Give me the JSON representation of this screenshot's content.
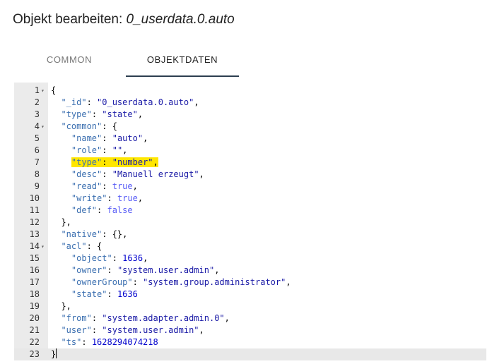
{
  "dialog": {
    "title_prefix": "Objekt bearbeiten: ",
    "object_id": "0_userdata.0.auto"
  },
  "tabs": [
    {
      "label": "COMMON",
      "active": false
    },
    {
      "label": "OBJEKTDATEN",
      "active": true
    }
  ],
  "editor": {
    "active_line": 23,
    "fold_icon": "triangle-down-icon",
    "colors": {
      "gutter": "#ebebeb",
      "key": "#3b6fb0",
      "string": "#1a1aa6",
      "number": "#0000cd",
      "highlight": "#ffe600"
    },
    "lines": [
      {
        "n": "1",
        "fold": true,
        "tokens": [
          {
            "t": "{"
          }
        ]
      },
      {
        "n": "2",
        "tokens": [
          {
            "t": "  "
          },
          {
            "t": "\"_id\"",
            "c": "k"
          },
          {
            "t": ": "
          },
          {
            "t": "\"0_userdata.0.auto\"",
            "c": "s"
          },
          {
            "t": ","
          }
        ]
      },
      {
        "n": "3",
        "tokens": [
          {
            "t": "  "
          },
          {
            "t": "\"type\"",
            "c": "k"
          },
          {
            "t": ": "
          },
          {
            "t": "\"state\"",
            "c": "s"
          },
          {
            "t": ","
          }
        ]
      },
      {
        "n": "4",
        "fold": true,
        "tokens": [
          {
            "t": "  "
          },
          {
            "t": "\"common\"",
            "c": "k"
          },
          {
            "t": ": {"
          }
        ]
      },
      {
        "n": "5",
        "tokens": [
          {
            "t": "    "
          },
          {
            "t": "\"name\"",
            "c": "k"
          },
          {
            "t": ": "
          },
          {
            "t": "\"auto\"",
            "c": "s"
          },
          {
            "t": ","
          }
        ]
      },
      {
        "n": "6",
        "tokens": [
          {
            "t": "    "
          },
          {
            "t": "\"role\"",
            "c": "k"
          },
          {
            "t": ": "
          },
          {
            "t": "\"\"",
            "c": "s"
          },
          {
            "t": ","
          }
        ]
      },
      {
        "n": "7",
        "highlight": true,
        "tokens": [
          {
            "t": "    "
          },
          {
            "t": "\"type\"",
            "c": "k",
            "hl": true
          },
          {
            "t": ": ",
            "hl": true
          },
          {
            "t": "\"number\"",
            "c": "s",
            "hl": true
          },
          {
            "t": ",",
            "hl": true
          }
        ]
      },
      {
        "n": "8",
        "tokens": [
          {
            "t": "    "
          },
          {
            "t": "\"desc\"",
            "c": "k"
          },
          {
            "t": ": "
          },
          {
            "t": "\"Manuell erzeugt\"",
            "c": "s"
          },
          {
            "t": ","
          }
        ]
      },
      {
        "n": "9",
        "tokens": [
          {
            "t": "    "
          },
          {
            "t": "\"read\"",
            "c": "k"
          },
          {
            "t": ": "
          },
          {
            "t": "true",
            "c": "b"
          },
          {
            "t": ","
          }
        ]
      },
      {
        "n": "10",
        "tokens": [
          {
            "t": "    "
          },
          {
            "t": "\"write\"",
            "c": "k"
          },
          {
            "t": ": "
          },
          {
            "t": "true",
            "c": "b"
          },
          {
            "t": ","
          }
        ]
      },
      {
        "n": "11",
        "tokens": [
          {
            "t": "    "
          },
          {
            "t": "\"def\"",
            "c": "k"
          },
          {
            "t": ": "
          },
          {
            "t": "false",
            "c": "b"
          }
        ]
      },
      {
        "n": "12",
        "tokens": [
          {
            "t": "  },"
          }
        ]
      },
      {
        "n": "13",
        "tokens": [
          {
            "t": "  "
          },
          {
            "t": "\"native\"",
            "c": "k"
          },
          {
            "t": ": {},"
          }
        ]
      },
      {
        "n": "14",
        "fold": true,
        "tokens": [
          {
            "t": "  "
          },
          {
            "t": "\"acl\"",
            "c": "k"
          },
          {
            "t": ": {"
          }
        ]
      },
      {
        "n": "15",
        "tokens": [
          {
            "t": "    "
          },
          {
            "t": "\"object\"",
            "c": "k"
          },
          {
            "t": ": "
          },
          {
            "t": "1636",
            "c": "n"
          },
          {
            "t": ","
          }
        ]
      },
      {
        "n": "16",
        "tokens": [
          {
            "t": "    "
          },
          {
            "t": "\"owner\"",
            "c": "k"
          },
          {
            "t": ": "
          },
          {
            "t": "\"system.user.admin\"",
            "c": "s"
          },
          {
            "t": ","
          }
        ]
      },
      {
        "n": "17",
        "tokens": [
          {
            "t": "    "
          },
          {
            "t": "\"ownerGroup\"",
            "c": "k"
          },
          {
            "t": ": "
          },
          {
            "t": "\"system.group.administrator\"",
            "c": "s"
          },
          {
            "t": ","
          }
        ]
      },
      {
        "n": "18",
        "tokens": [
          {
            "t": "    "
          },
          {
            "t": "\"state\"",
            "c": "k"
          },
          {
            "t": ": "
          },
          {
            "t": "1636",
            "c": "n"
          }
        ]
      },
      {
        "n": "19",
        "tokens": [
          {
            "t": "  },"
          }
        ]
      },
      {
        "n": "20",
        "tokens": [
          {
            "t": "  "
          },
          {
            "t": "\"from\"",
            "c": "k"
          },
          {
            "t": ": "
          },
          {
            "t": "\"system.adapter.admin.0\"",
            "c": "s"
          },
          {
            "t": ","
          }
        ]
      },
      {
        "n": "21",
        "tokens": [
          {
            "t": "  "
          },
          {
            "t": "\"user\"",
            "c": "k"
          },
          {
            "t": ": "
          },
          {
            "t": "\"system.user.admin\"",
            "c": "s"
          },
          {
            "t": ","
          }
        ]
      },
      {
        "n": "22",
        "tokens": [
          {
            "t": "  "
          },
          {
            "t": "\"ts\"",
            "c": "k"
          },
          {
            "t": ": "
          },
          {
            "t": "1628294074218",
            "c": "n"
          }
        ]
      },
      {
        "n": "23",
        "cursor": true,
        "tokens": [
          {
            "t": "}"
          }
        ]
      }
    ]
  }
}
